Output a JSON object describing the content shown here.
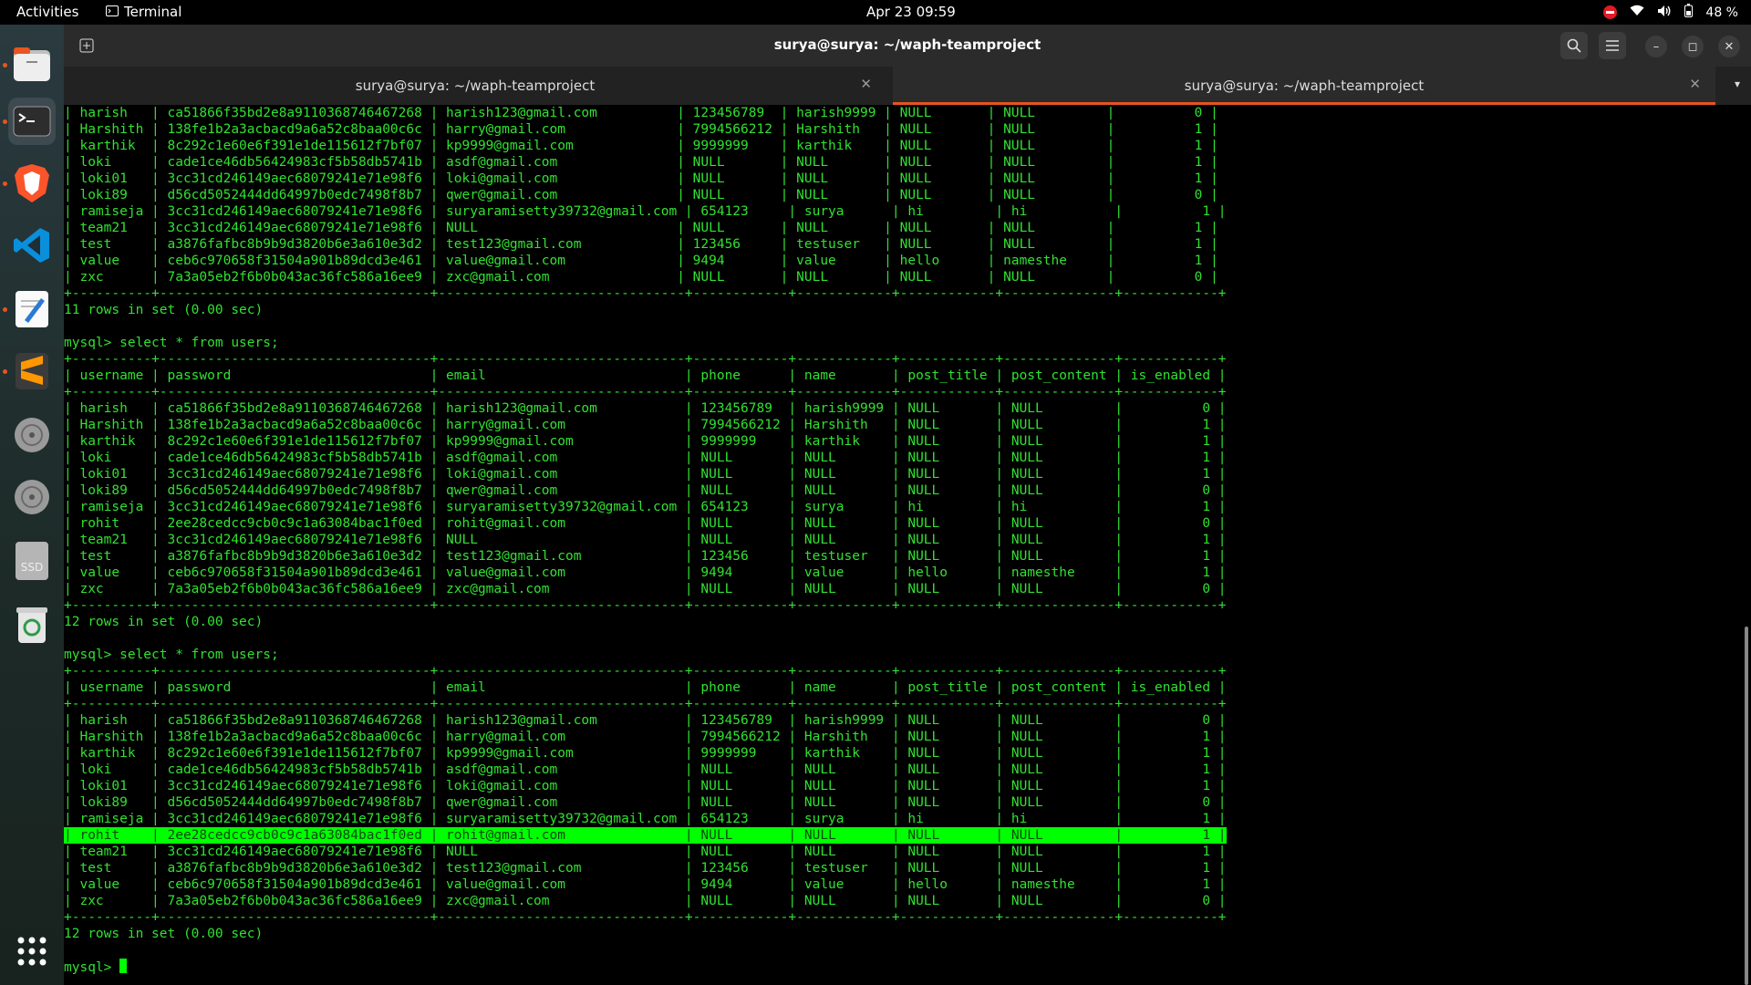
{
  "topbar": {
    "activities": "Activities",
    "app": "Terminal",
    "clock": "Apr 23  09:59",
    "battery": "48 %"
  },
  "dock": {
    "items": [
      "Files",
      "Terminal",
      "Brave Browser",
      "Visual Studio Code",
      "Text Editor",
      "Sublime Text",
      "Disc",
      "Disc",
      "SSD",
      "Trash",
      "Show Applications"
    ]
  },
  "window": {
    "title": "surya@surya: ~/waph-teamproject",
    "tabs": [
      {
        "label": "surya@surya: ~/waph-teamproject",
        "active": false
      },
      {
        "label": "surya@surya: ~/waph-teamproject",
        "active": true
      }
    ]
  },
  "terminal": {
    "top_rows": [
      "| harish   | ca51866f35bd2e8a9110368746467268 | harish123@gmail.com          | 123456789  | harish9999 | NULL       | NULL         |          0 |",
      "| Harshith | 138fe1b2a3acbacd9a6a52c8baa00c6c | harry@gmail.com              | 7994566212 | Harshith   | NULL       | NULL         |          1 |",
      "| karthik  | 8c292c1e60e6f391e1de115612f7bf07 | kp9999@gmail.com             | 9999999    | karthik    | NULL       | NULL         |          1 |",
      "| loki     | cade1ce46db56424983cf5b58db5741b | asdf@gmail.com               | NULL       | NULL       | NULL       | NULL         |          1 |",
      "| loki01   | 3cc31cd246149aec68079241e71e98f6 | loki@gmail.com               | NULL       | NULL       | NULL       | NULL         |          1 |",
      "| loki89   | d56cd5052444dd64997b0edc7498f8b7 | qwer@gmail.com               | NULL       | NULL       | NULL       | NULL         |          0 |",
      "| ramiseja | 3cc31cd246149aec68079241e71e98f6 | suryaramisetty39732@gmail.com | 654123     | surya      | hi         | hi           |          1 |",
      "| team21   | 3cc31cd246149aec68079241e71e98f6 | NULL                         | NULL       | NULL       | NULL       | NULL         |          1 |",
      "| test     | a3876fafbc8b9b9d3820b6e3a610e3d2 | test123@gmail.com            | 123456     | testuser   | NULL       | NULL         |          1 |",
      "| value    | ceb6c970658f31504a901b89dcd3e461 | value@gmail.com              | 9494       | value      | hello      | namesthe     |          1 |",
      "| zxc      | 7a3a05eb2f6b0b043ac36fc586a16ee9 | zxc@gmail.com                | NULL       | NULL       | NULL       | NULL         |          0 |"
    ],
    "border": "+----------+----------------------------------+-------------------------------+------------+------------+------------+--------------+------------+",
    "header": "| username | password                         | email                         | phone      | name       | post_title | post_content | is_enabled |",
    "summary1": "11 rows in set (0.00 sec)",
    "query": "mysql> select * from users;",
    "rows12": [
      "| harish   | ca51866f35bd2e8a9110368746467268 | harish123@gmail.com           | 123456789  | harish9999 | NULL       | NULL         |          0 |",
      "| Harshith | 138fe1b2a3acbacd9a6a52c8baa00c6c | harry@gmail.com               | 7994566212 | Harshith   | NULL       | NULL         |          1 |",
      "| karthik  | 8c292c1e60e6f391e1de115612f7bf07 | kp9999@gmail.com              | 9999999    | karthik    | NULL       | NULL         |          1 |",
      "| loki     | cade1ce46db56424983cf5b58db5741b | asdf@gmail.com                | NULL       | NULL       | NULL       | NULL         |          1 |",
      "| loki01   | 3cc31cd246149aec68079241e71e98f6 | loki@gmail.com                | NULL       | NULL       | NULL       | NULL         |          1 |",
      "| loki89   | d56cd5052444dd64997b0edc7498f8b7 | qwer@gmail.com                | NULL       | NULL       | NULL       | NULL         |          0 |",
      "| ramiseja | 3cc31cd246149aec68079241e71e98f6 | suryaramisetty39732@gmail.com | 654123     | surya      | hi         | hi           |          1 |",
      "| rohit    | 2ee28cedcc9cb0c9c1a63084bac1f0ed | rohit@gmail.com               | NULL       | NULL       | NULL       | NULL         |          0 |",
      "| team21   | 3cc31cd246149aec68079241e71e98f6 | NULL                          | NULL       | NULL       | NULL       | NULL         |          1 |",
      "| test     | a3876fafbc8b9b9d3820b6e3a610e3d2 | test123@gmail.com             | 123456     | testuser   | NULL       | NULL         |          1 |",
      "| value    | ceb6c970658f31504a901b89dcd3e461 | value@gmail.com               | 9494       | value      | hello      | namesthe     |          1 |",
      "| zxc      | 7a3a05eb2f6b0b043ac36fc586a16ee9 | zxc@gmail.com                 | NULL       | NULL       | NULL       | NULL         |          0 |"
    ],
    "summary2": "12 rows in set (0.00 sec)",
    "rows_final_before": [
      "| harish   | ca51866f35bd2e8a9110368746467268 | harish123@gmail.com           | 123456789  | harish9999 | NULL       | NULL         |          0 |",
      "| Harshith | 138fe1b2a3acbacd9a6a52c8baa00c6c | harry@gmail.com               | 7994566212 | Harshith   | NULL       | NULL         |          1 |",
      "| karthik  | 8c292c1e60e6f391e1de115612f7bf07 | kp9999@gmail.com              | 9999999    | karthik    | NULL       | NULL         |          1 |",
      "| loki     | cade1ce46db56424983cf5b58db5741b | asdf@gmail.com                | NULL       | NULL       | NULL       | NULL         |          1 |",
      "| loki01   | 3cc31cd246149aec68079241e71e98f6 | loki@gmail.com                | NULL       | NULL       | NULL       | NULL         |          1 |",
      "| loki89   | d56cd5052444dd64997b0edc7498f8b7 | qwer@gmail.com                | NULL       | NULL       | NULL       | NULL         |          0 |",
      "| ramiseja | 3cc31cd246149aec68079241e71e98f6 | suryaramisetty39732@gmail.com | 654123     | surya      | hi         | hi           |          1 |"
    ],
    "row_highlight": "| rohit    | 2ee28cedcc9cb0c9c1a63084bac1f0ed | rohit@gmail.com               | NULL       | NULL       | NULL       | NULL         |          1 |",
    "rows_final_after": [
      "| team21   | 3cc31cd246149aec68079241e71e98f6 | NULL                          | NULL       | NULL       | NULL       | NULL         |          1 |",
      "| test     | a3876fafbc8b9b9d3820b6e3a610e3d2 | test123@gmail.com             | 123456     | testuser   | NULL       | NULL         |          1 |",
      "| value    | ceb6c970658f31504a901b89dcd3e461 | value@gmail.com               | 9494       | value      | hello      | namesthe     |          1 |",
      "| zxc      | 7a3a05eb2f6b0b043ac36fc586a16ee9 | zxc@gmail.com                 | NULL       | NULL       | NULL       | NULL         |          0 |"
    ],
    "summary3": "12 rows in set (0.00 sec)",
    "prompt": "mysql> "
  }
}
